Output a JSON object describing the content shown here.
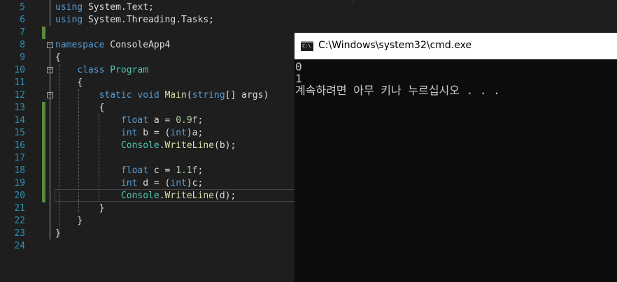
{
  "editor": {
    "lines": [
      {
        "num": "5",
        "code": [
          {
            "t": "using",
            "c": "kw"
          },
          {
            "t": " System.Text;"
          }
        ]
      },
      {
        "num": "6",
        "code": [
          {
            "t": "using",
            "c": "kw"
          },
          {
            "t": " System.Threading.Tasks;"
          }
        ]
      },
      {
        "num": "7",
        "code": []
      },
      {
        "num": "8",
        "code": [
          {
            "t": "namespace",
            "c": "kw"
          },
          {
            "t": " ConsoleApp4"
          }
        ]
      },
      {
        "num": "9",
        "code": [
          {
            "t": "{"
          }
        ]
      },
      {
        "num": "10",
        "code": [
          {
            "t": "    "
          },
          {
            "t": "class",
            "c": "kw"
          },
          {
            "t": " "
          },
          {
            "t": "Program",
            "c": "ty"
          }
        ]
      },
      {
        "num": "11",
        "code": [
          {
            "t": "    {"
          }
        ]
      },
      {
        "num": "12",
        "code": [
          {
            "t": "        "
          },
          {
            "t": "static",
            "c": "kw"
          },
          {
            "t": " "
          },
          {
            "t": "void",
            "c": "kw"
          },
          {
            "t": " "
          },
          {
            "t": "Main",
            "c": "fn"
          },
          {
            "t": "("
          },
          {
            "t": "string",
            "c": "kw"
          },
          {
            "t": "[] args)"
          }
        ]
      },
      {
        "num": "13",
        "code": [
          {
            "t": "        {"
          }
        ]
      },
      {
        "num": "14",
        "code": [
          {
            "t": "            "
          },
          {
            "t": "float",
            "c": "kw"
          },
          {
            "t": " a = "
          },
          {
            "t": "0.9f",
            "c": "num"
          },
          {
            "t": ";"
          }
        ]
      },
      {
        "num": "15",
        "code": [
          {
            "t": "            "
          },
          {
            "t": "int",
            "c": "kw"
          },
          {
            "t": " b = ("
          },
          {
            "t": "int",
            "c": "kw"
          },
          {
            "t": ")a;"
          }
        ]
      },
      {
        "num": "16",
        "code": [
          {
            "t": "            "
          },
          {
            "t": "Console",
            "c": "ty"
          },
          {
            "t": "."
          },
          {
            "t": "WriteLine",
            "c": "fn"
          },
          {
            "t": "(b);"
          }
        ]
      },
      {
        "num": "17",
        "code": []
      },
      {
        "num": "18",
        "code": [
          {
            "t": "            "
          },
          {
            "t": "float",
            "c": "kw"
          },
          {
            "t": " c = "
          },
          {
            "t": "1.1f",
            "c": "num"
          },
          {
            "t": ";"
          }
        ]
      },
      {
        "num": "19",
        "code": [
          {
            "t": "            "
          },
          {
            "t": "int",
            "c": "kw"
          },
          {
            "t": " d = ("
          },
          {
            "t": "int",
            "c": "kw"
          },
          {
            "t": ")c;"
          }
        ]
      },
      {
        "num": "20",
        "code": [
          {
            "t": "            "
          },
          {
            "t": "Console",
            "c": "ty"
          },
          {
            "t": "."
          },
          {
            "t": "WriteLine",
            "c": "fn"
          },
          {
            "t": "(d);"
          }
        ]
      },
      {
        "num": "21",
        "code": [
          {
            "t": "        }"
          }
        ]
      },
      {
        "num": "22",
        "code": [
          {
            "t": "    }"
          }
        ]
      },
      {
        "num": "23",
        "code": [
          {
            "t": "}"
          }
        ]
      },
      {
        "num": "24",
        "code": []
      }
    ]
  },
  "cmd": {
    "title": "C:\\Windows\\system32\\cmd.exe",
    "icon": "cmd-window-icon",
    "output": [
      "0",
      "1",
      "계속하려면 아무 키나 누르십시오 . . ."
    ]
  },
  "colors": {
    "keyword": "#569cd6",
    "type": "#4ec9b0",
    "method": "#dcdcaa",
    "number": "#b5cea8",
    "line_number": "#2b91af",
    "change_bar": "#5a8a3c"
  }
}
